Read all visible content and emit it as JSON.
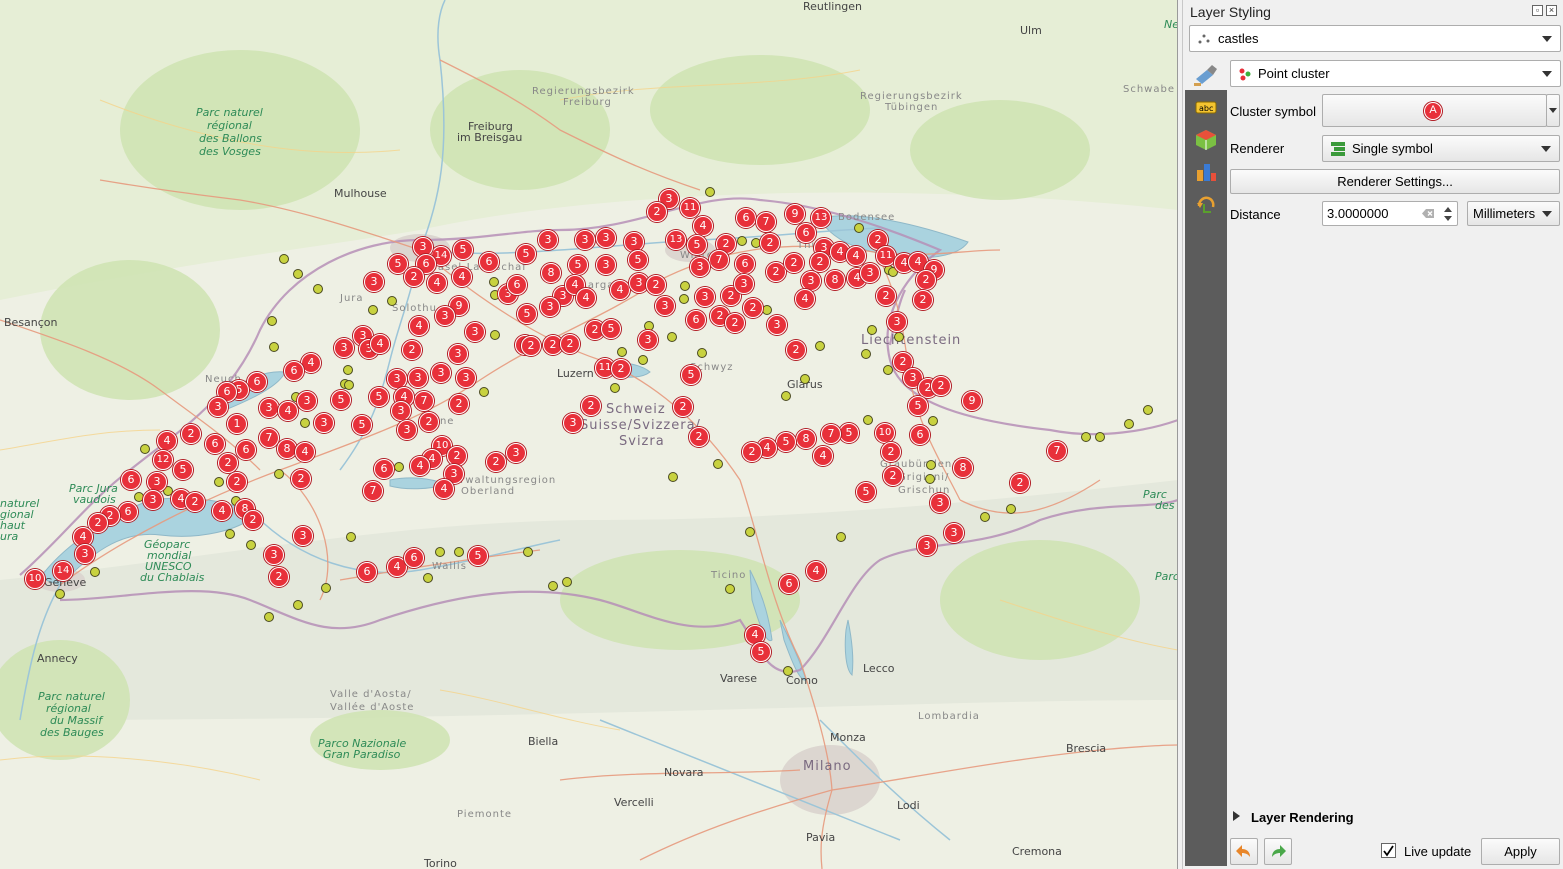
{
  "map": {
    "places": [
      {
        "text": "Reutlingen",
        "cls": "city"
      },
      {
        "text": "Ulm",
        "cls": "city"
      },
      {
        "text": "Regierungsbezirk",
        "cls": "region"
      },
      {
        "text": "Freiburg",
        "cls": "region"
      },
      {
        "text": "Freiburg",
        "cls": "city"
      },
      {
        "text": "im Breisgau",
        "cls": "city"
      },
      {
        "text": "Regierungsbezirk",
        "cls": "region"
      },
      {
        "text": "Tübingen",
        "cls": "region"
      },
      {
        "text": "Schwabe",
        "cls": "region"
      },
      {
        "text": "Parc naturel",
        "cls": "park"
      },
      {
        "text": "régional",
        "cls": "park"
      },
      {
        "text": "des Ballons",
        "cls": "park"
      },
      {
        "text": "des Vosges",
        "cls": "park"
      },
      {
        "text": "Mulhouse",
        "cls": "city"
      },
      {
        "text": "Besançon",
        "cls": "city"
      },
      {
        "text": "Bodensee",
        "cls": "region"
      },
      {
        "text": "Liechtenstein",
        "cls": "country"
      },
      {
        "text": "Schweiz",
        "cls": "country"
      },
      {
        "text": "Suisse/Svizzera/",
        "cls": "country"
      },
      {
        "text": "Svizra",
        "cls": "country"
      },
      {
        "text": "Luzern",
        "cls": "city"
      },
      {
        "text": "Glarus",
        "cls": "city"
      },
      {
        "text": "Graubünden/",
        "cls": "region"
      },
      {
        "text": "Grigioni/",
        "cls": "region"
      },
      {
        "text": "Grischun",
        "cls": "region"
      },
      {
        "text": "Verwaltungsregion",
        "cls": "region"
      },
      {
        "text": "Oberland",
        "cls": "region"
      },
      {
        "text": "Parc Jura",
        "cls": "park"
      },
      {
        "text": "vaudois",
        "cls": "park"
      },
      {
        "text": "Géoparc",
        "cls": "park"
      },
      {
        "text": "mondial",
        "cls": "park"
      },
      {
        "text": "UNESCO",
        "cls": "park"
      },
      {
        "text": "du Chablais",
        "cls": "park"
      },
      {
        "text": "Genève",
        "cls": "city"
      },
      {
        "text": "Annecy",
        "cls": "city"
      },
      {
        "text": "Parc naturel",
        "cls": "park"
      },
      {
        "text": "régional",
        "cls": "park"
      },
      {
        "text": "du Massif",
        "cls": "park"
      },
      {
        "text": "des Bauges",
        "cls": "park"
      },
      {
        "text": "Valle d'Aosta/",
        "cls": "region"
      },
      {
        "text": "Vallée d'Aoste",
        "cls": "region"
      },
      {
        "text": "Parco Nazionale",
        "cls": "park"
      },
      {
        "text": "Gran Paradiso",
        "cls": "park"
      },
      {
        "text": "Ticino",
        "cls": "region"
      },
      {
        "text": "Wallis",
        "cls": "region"
      },
      {
        "text": "Biella",
        "cls": "city"
      },
      {
        "text": "Varese",
        "cls": "city"
      },
      {
        "text": "Como",
        "cls": "city"
      },
      {
        "text": "Lecco",
        "cls": "city"
      },
      {
        "text": "Lombardia",
        "cls": "region"
      },
      {
        "text": "Brescia",
        "cls": "city"
      },
      {
        "text": "Monza",
        "cls": "city"
      },
      {
        "text": "Milano",
        "cls": "country"
      },
      {
        "text": "Novara",
        "cls": "city"
      },
      {
        "text": "Vercelli",
        "cls": "city"
      },
      {
        "text": "Lodi",
        "cls": "city"
      },
      {
        "text": "Pavia",
        "cls": "city"
      },
      {
        "text": "Cremona",
        "cls": "city"
      },
      {
        "text": "Piemonte",
        "cls": "region"
      },
      {
        "text": "Torino",
        "cls": "city"
      },
      {
        "text": "Jura",
        "cls": "region"
      },
      {
        "text": "Solothu",
        "cls": "region"
      },
      {
        "text": "Neuch",
        "cls": "region"
      },
      {
        "text": "Berne",
        "cls": "region"
      },
      {
        "text": "Schwyz",
        "cls": "region"
      },
      {
        "text": "Thur",
        "cls": "region"
      },
      {
        "text": "Basel-Landschaf",
        "cls": "region"
      },
      {
        "text": "Aargau",
        "cls": "region"
      },
      {
        "text": "Winter",
        "cls": "region"
      },
      {
        "text": "Parc",
        "cls": "park"
      },
      {
        "text": "des",
        "cls": "park"
      },
      {
        "text": "Parc",
        "cls": "park"
      },
      {
        "text": "naturel",
        "cls": "park"
      },
      {
        "text": "gional",
        "cls": "park"
      },
      {
        "text": "haut",
        "cls": "park"
      },
      {
        "text": "ura",
        "cls": "park"
      },
      {
        "text": "Ne",
        "cls": "park"
      }
    ],
    "clusters": [
      "3",
      "2",
      "11",
      "4",
      "6",
      "7",
      "9",
      "13",
      "3",
      "3",
      "3",
      "13",
      "5",
      "3",
      "2",
      "6",
      "3",
      "4",
      "4",
      "2",
      "5",
      "2",
      "14",
      "5",
      "5",
      "3",
      "6",
      "6",
      "5",
      "8",
      "5",
      "3",
      "7",
      "6",
      "2",
      "2",
      "2",
      "11",
      "4",
      "4",
      "9",
      "3",
      "2",
      "4",
      "3",
      "4",
      "3",
      "6",
      "3",
      "4",
      "2",
      "3",
      "8",
      "4",
      "3",
      "2",
      "2",
      "9",
      "3",
      "4",
      "3",
      "2",
      "4",
      "5",
      "2",
      "3",
      "3",
      "3",
      "4",
      "6",
      "2",
      "2",
      "2",
      "3",
      "3",
      "5",
      "2",
      "2",
      "2",
      "5",
      "3",
      "4",
      "3",
      "2",
      "3",
      "3",
      "3",
      "4",
      "2",
      "3",
      "2",
      "3",
      "2",
      "3",
      "4",
      "6",
      "3",
      "3",
      "3",
      "3",
      "11",
      "2",
      "5",
      "6",
      "5",
      "6",
      "3",
      "4",
      "3",
      "5",
      "5",
      "7",
      "4",
      "3",
      "2",
      "3",
      "2",
      "2",
      "5",
      "9",
      "3",
      "5",
      "2",
      "3",
      "1",
      "2",
      "2",
      "3",
      "10",
      "6",
      "5",
      "7",
      "8",
      "5",
      "4",
      "2",
      "2",
      "4",
      "2",
      "6",
      "6",
      "7",
      "8",
      "4",
      "10",
      "2",
      "4",
      "4",
      "3",
      "4",
      "6",
      "7",
      "2",
      "2",
      "2",
      "12",
      "5",
      "6",
      "3",
      "3",
      "4",
      "2",
      "4",
      "8",
      "2",
      "6",
      "2",
      "2",
      "4",
      "3",
      "14",
      "10",
      "3",
      "3",
      "2",
      "6",
      "4",
      "6",
      "5",
      "2",
      "3",
      "2",
      "2",
      "5",
      "8",
      "3",
      "2",
      "7",
      "3",
      "3",
      "4",
      "4",
      "6",
      "4",
      "5",
      "6",
      "2",
      "2",
      "2",
      "2",
      "2",
      "3",
      "2",
      "2"
    ]
  },
  "panel": {
    "title": "Layer Styling",
    "layer_combo": "castles",
    "renderer_type_combo": "Point cluster",
    "cluster_symbol_label": "Cluster symbol",
    "cluster_symbol_preview": "A",
    "renderer_label": "Renderer",
    "renderer_combo": "Single symbol",
    "renderer_settings_button": "Renderer Settings...",
    "distance_label": "Distance",
    "distance_value": "3.0000000",
    "distance_unit": "Millimeters",
    "layer_rendering": "Layer Rendering",
    "live_update": "Live update",
    "apply": "Apply"
  },
  "colors": {
    "cluster_fill": "#e8303a",
    "point_fill": "#c8d240",
    "sidebar": "#5c5c5c"
  }
}
